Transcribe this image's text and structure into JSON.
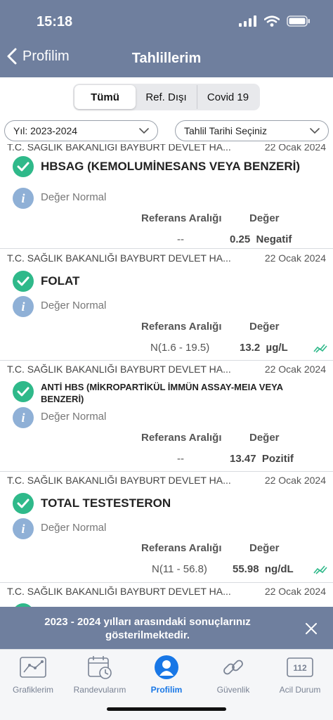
{
  "status_bar": {
    "time": "15:18"
  },
  "nav": {
    "back_label": "Profilim",
    "title": "Tahlillerim"
  },
  "segments": [
    {
      "label": "Tümü",
      "active": true
    },
    {
      "label": "Ref. Dışı",
      "active": false
    },
    {
      "label": "Covid 19",
      "active": false
    }
  ],
  "filters": {
    "year": "Yıl: 2023-2024",
    "date": "Tahlil Tarihi Seçiniz"
  },
  "results": [
    {
      "hospital": "T.C. SAĞLIK BAKANLIĞI BAYBURT DEVLET HA...",
      "date": "22 Ocak 2024",
      "test": "HBSAG (KEMOLUMİNESANS VEYA BENZERİ)",
      "status": "Değer Normal",
      "ref_header": "Referans Aralığı",
      "val_header": "Değer",
      "ref": "--",
      "value": "0.25",
      "unit": "Negatif",
      "has_trend": false
    },
    {
      "hospital": "T.C. SAĞLIK BAKANLIĞI BAYBURT DEVLET HA...",
      "date": "22 Ocak 2024",
      "test": "FOLAT",
      "status": "Değer Normal",
      "ref_header": "Referans Aralığı",
      "val_header": "Değer",
      "ref": "N(1.6 - 19.5)",
      "value": "13.2",
      "unit": "µg/L",
      "has_trend": true
    },
    {
      "hospital": "T.C. SAĞLIK BAKANLIĞI BAYBURT DEVLET HA...",
      "date": "22 Ocak 2024",
      "test": "ANTİ HBS (MİKROPARTİKÜL İMMÜN ASSAY-MEIA VEYA BENZERİ)",
      "status": "Değer Normal",
      "ref_header": "Referans Aralığı",
      "val_header": "Değer",
      "ref": "--",
      "value": "13.47",
      "unit": "Pozitif",
      "has_trend": false
    },
    {
      "hospital": "T.C. SAĞLIK BAKANLIĞI BAYBURT DEVLET HA...",
      "date": "22 Ocak 2024",
      "test": "TOTAL TESTESTERON",
      "status": "Değer Normal",
      "ref_header": "Referans Aralığı",
      "val_header": "Değer",
      "ref": "N(11 - 56.8)",
      "value": "55.98",
      "unit": "ng/dL",
      "has_trend": true
    },
    {
      "hospital": "T.C. SAĞLIK BAKANLIĞI BAYBURT DEVLET HA...",
      "date": "22 Ocak 2024"
    }
  ],
  "banner": {
    "text": "2023 - 2024 yılları arasındaki sonuçlarınız gösterilmektedir."
  },
  "tabs": [
    {
      "label": "Grafiklerim",
      "icon": "chart-icon",
      "active": false
    },
    {
      "label": "Randevularım",
      "icon": "calendar-icon",
      "active": false
    },
    {
      "label": "Profilim",
      "icon": "profile-icon",
      "active": true
    },
    {
      "label": "Güvenlik",
      "icon": "link-icon",
      "active": false
    },
    {
      "label": "Acil Durum",
      "icon": "emergency-icon",
      "active": false,
      "badge": "112"
    }
  ],
  "colors": {
    "header_bg": "#6f7f9e",
    "check_green": "#2fb98a",
    "info_blue": "#8fb0d6",
    "active_tab": "#1877e6"
  }
}
